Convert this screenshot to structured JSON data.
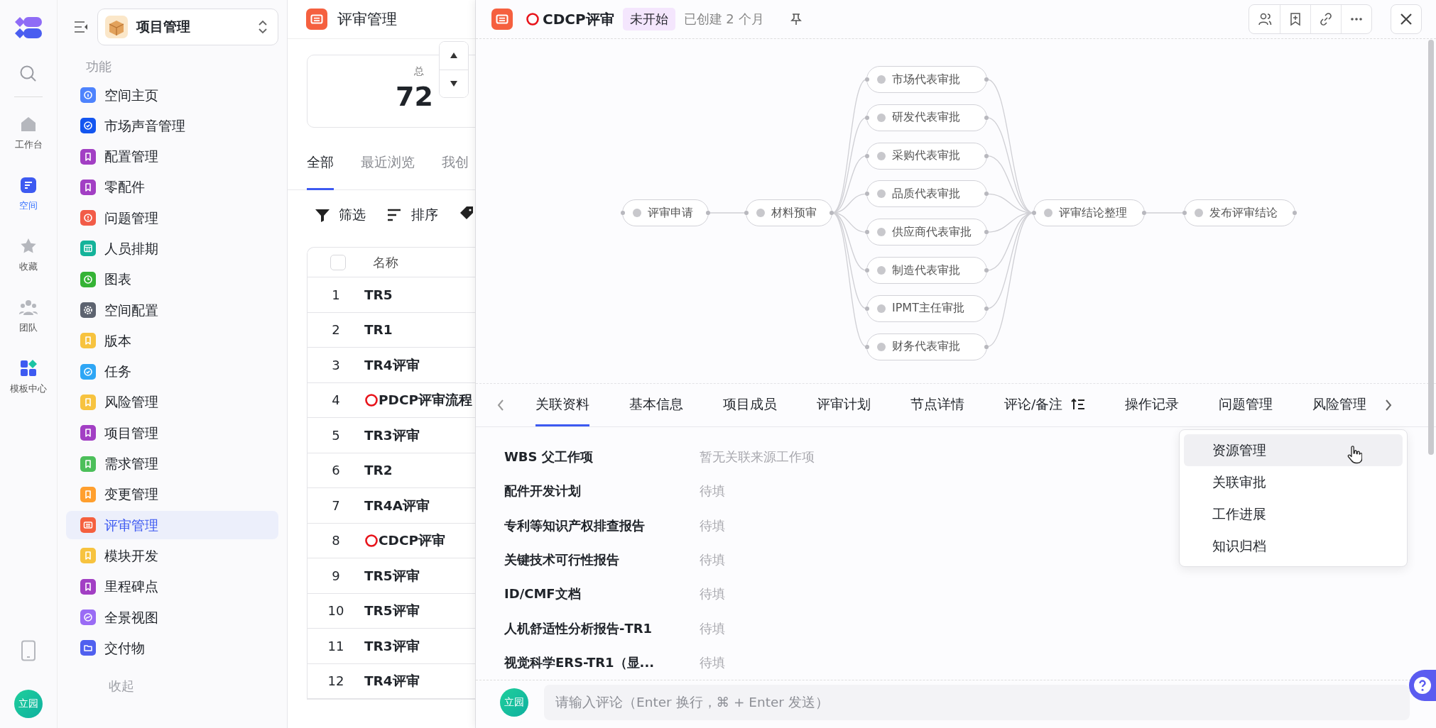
{
  "rail": {
    "items": [
      {
        "label": "工作台",
        "kind": "home",
        "selected": false
      },
      {
        "label": "空间",
        "kind": "space",
        "selected": true
      },
      {
        "label": "收藏",
        "kind": "star",
        "selected": false
      },
      {
        "label": "团队",
        "kind": "team",
        "selected": false
      },
      {
        "label": "模板中心",
        "kind": "template",
        "selected": false
      }
    ],
    "avatar": "立园"
  },
  "sidebar": {
    "space": "项目管理",
    "section": "功能",
    "items": [
      {
        "label": "空间主页",
        "kind": "info",
        "color": "#4e83fd",
        "selected": false
      },
      {
        "label": "市场声音管理",
        "kind": "check",
        "color": "#1456f0",
        "selected": false
      },
      {
        "label": "配置管理",
        "kind": "bookmark",
        "color": "#a23fc4",
        "selected": false
      },
      {
        "label": "零配件",
        "kind": "bookmark",
        "color": "#a23fc4",
        "selected": false
      },
      {
        "label": "问题管理",
        "kind": "alert",
        "color": "#f25c48",
        "selected": false
      },
      {
        "label": "人员排期",
        "kind": "grid",
        "color": "#14b39a",
        "selected": false
      },
      {
        "label": "图表",
        "kind": "clock",
        "color": "#35b335",
        "selected": false
      },
      {
        "label": "空间配置",
        "kind": "gear",
        "color": "#5d6370",
        "selected": false
      },
      {
        "label": "版本",
        "kind": "bookmark",
        "color": "#f7c33f",
        "selected": false
      },
      {
        "label": "任务",
        "kind": "check",
        "color": "#2ea6f5",
        "selected": false
      },
      {
        "label": "风险管理",
        "kind": "bookmark",
        "color": "#f7c33f",
        "selected": false
      },
      {
        "label": "项目管理",
        "kind": "bookmark",
        "color": "#a23fc4",
        "selected": false
      },
      {
        "label": "需求管理",
        "kind": "bookmark",
        "color": "#4cbf5a",
        "selected": false
      },
      {
        "label": "变更管理",
        "kind": "bookmark",
        "color": "#ff9f2e",
        "selected": false
      },
      {
        "label": "评审管理",
        "kind": "board",
        "color": "#f5603f",
        "selected": true
      },
      {
        "label": "模块开发",
        "kind": "bookmark",
        "color": "#f7c33f",
        "selected": false
      },
      {
        "label": "里程碑点",
        "kind": "bookmark",
        "color": "#a23fc4",
        "selected": false
      },
      {
        "label": "全景视图",
        "kind": "swirl",
        "color": "#9a6cf5",
        "selected": false
      },
      {
        "label": "交付物",
        "kind": "folder",
        "color": "#5060ef",
        "selected": false
      }
    ],
    "collapse": "收起"
  },
  "list": {
    "title": "评审管理",
    "stat": {
      "label": "总",
      "value": "72"
    },
    "tabs": [
      {
        "label": "全部",
        "selected": true
      },
      {
        "label": "最近浏览",
        "selected": false
      },
      {
        "label": "我创",
        "selected": false
      }
    ],
    "toolbar": [
      "筛选",
      "排序"
    ],
    "table": {
      "select_all": {
        "checked": false
      },
      "columns": [
        "名称"
      ],
      "rows": [
        {
          "index": "1",
          "name": "TR5",
          "marked": false
        },
        {
          "index": "2",
          "name": "TR1",
          "marked": false
        },
        {
          "index": "3",
          "name": "TR4评审",
          "marked": false
        },
        {
          "index": "4",
          "name": "PDCP评审流程",
          "marked": true
        },
        {
          "index": "5",
          "name": "TR3评审",
          "marked": false
        },
        {
          "index": "6",
          "name": "TR2",
          "marked": false
        },
        {
          "index": "7",
          "name": "TR4A评审",
          "marked": false
        },
        {
          "index": "8",
          "name": "CDCP评审",
          "marked": true
        },
        {
          "index": "9",
          "name": "TR5评审",
          "marked": false
        },
        {
          "index": "10",
          "name": "TR5评审",
          "marked": false
        },
        {
          "index": "11",
          "name": "TR3评审",
          "marked": false
        },
        {
          "index": "12",
          "name": "TR4评审",
          "marked": false
        }
      ]
    }
  },
  "detail": {
    "title": "CDCP评审",
    "marked": true,
    "status": "未开始",
    "created": "已创建 2 个月",
    "flow": [
      {
        "label": "评审申请",
        "kind": "serial"
      },
      {
        "label": "材料预审",
        "kind": "serial"
      },
      {
        "label": "市场代表审批",
        "kind": "parallel"
      },
      {
        "label": "研发代表审批",
        "kind": "parallel"
      },
      {
        "label": "采购代表审批",
        "kind": "parallel"
      },
      {
        "label": "品质代表审批",
        "kind": "parallel"
      },
      {
        "label": "供应商代表审批",
        "kind": "parallel"
      },
      {
        "label": "制造代表审批",
        "kind": "parallel"
      },
      {
        "label": "IPMT主任审批",
        "kind": "parallel"
      },
      {
        "label": "财务代表审批",
        "kind": "parallel"
      },
      {
        "label": "评审结论整理",
        "kind": "serial"
      },
      {
        "label": "发布评审结论",
        "kind": "serial"
      }
    ],
    "tabs": [
      {
        "label": "关联资料",
        "selected": true,
        "sortable": false
      },
      {
        "label": "基本信息",
        "selected": false,
        "sortable": false
      },
      {
        "label": "项目成员",
        "selected": false,
        "sortable": false
      },
      {
        "label": "评审计划",
        "selected": false,
        "sortable": false
      },
      {
        "label": "节点详情",
        "selected": false,
        "sortable": false
      },
      {
        "label": "评论/备注",
        "selected": false,
        "sortable": true
      },
      {
        "label": "操作记录",
        "selected": false,
        "sortable": false
      },
      {
        "label": "问题管理",
        "selected": false,
        "sortable": false
      },
      {
        "label": "风险管理",
        "selected": false,
        "sortable": false
      }
    ],
    "more_menu": [
      {
        "label": "资源管理",
        "selected": true
      },
      {
        "label": "关联审批",
        "selected": false
      },
      {
        "label": "工作进展",
        "selected": false
      },
      {
        "label": "知识归档",
        "selected": false
      }
    ],
    "fields": [
      {
        "label": "WBS 父工作项",
        "placeholder": "暂无关联来源工作项"
      },
      {
        "label": "配件开发计划",
        "placeholder": "待填"
      },
      {
        "label": "专利等知识产权排查报告",
        "placeholder": "待填"
      },
      {
        "label": "关键技术可行性报告",
        "placeholder": "待填"
      },
      {
        "label": "ID/CMF文档",
        "placeholder": "待填"
      },
      {
        "label": "人机舒适性分析报告-TR1",
        "placeholder": "待填"
      },
      {
        "label": "视觉科学ERS-TR1（显...",
        "placeholder": "待填"
      }
    ],
    "comment": {
      "avatar": "立园",
      "placeholder": "请输入评论（Enter 换行，⌘ + Enter 发送）"
    }
  }
}
